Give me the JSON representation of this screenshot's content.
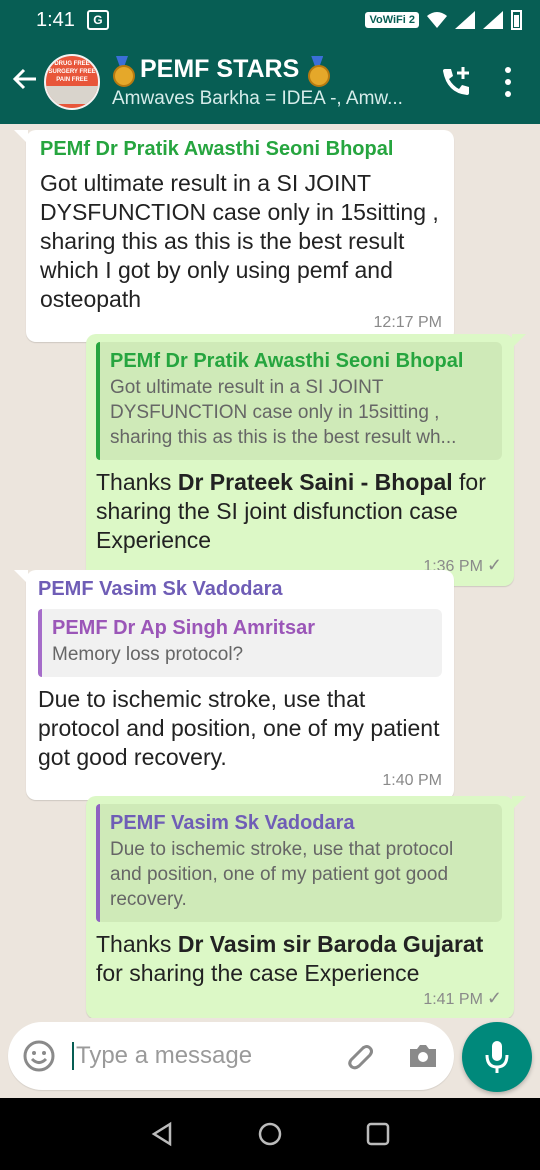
{
  "status_bar": {
    "time": "1:41",
    "network_label": "VoWiFi 2",
    "icons": [
      "translate-icon",
      "wifi-icon",
      "signal-icon",
      "battery-icon"
    ]
  },
  "header": {
    "title": "PEMF STARS",
    "subtitle": "Amwaves Barkha = IDEA -, Amw...",
    "avatar_text_1": "DRUG FREE",
    "avatar_text_2": "SURGERY FREE",
    "avatar_text_3": "PAIN FREE",
    "colors": {
      "bar": "#075e54"
    }
  },
  "messages": [
    {
      "direction": "in",
      "sender": "PEMf Dr Pratik Awasthi Seoni Bhopal",
      "text": "Got ultimate result in a SI JOINT DYSFUNCTION case only in 15sitting , sharing this as this is the best result which I got by only using pemf and osteopath",
      "time": "12:17 PM"
    },
    {
      "direction": "out",
      "quote": {
        "name": "PEMf Dr Pratik Awasthi Seoni Bhopal",
        "text": "Got ultimate result in a SI JOINT DYSFUNCTION case only in 15sitting , sharing this as this is the best result wh..."
      },
      "text_pre": "Thanks ",
      "text_bold": "Dr Prateek Saini - Bhopal",
      "text_post": " for sharing the SI joint disfunction case Experience",
      "time": "1:36 PM"
    },
    {
      "direction": "in",
      "sender": "PEMF Vasim Sk Vadodara",
      "quote": {
        "name": "PEMF Dr Ap Singh Amritsar",
        "text": "Memory loss protocol?"
      },
      "text": "Due to ischemic stroke, use that protocol and position, one of my patient got good recovery.",
      "time": "1:40 PM"
    },
    {
      "direction": "out",
      "quote": {
        "name": "PEMF Vasim Sk Vadodara",
        "text": "Due to ischemic stroke, use that protocol and position, one of my patient got good recovery."
      },
      "text_pre": "Thanks ",
      "text_bold": "Dr Vasim sir Baroda Gujarat",
      "text_post": " for sharing the case Experience",
      "time": "1:41 PM"
    }
  ],
  "composer": {
    "placeholder": "Type a message"
  },
  "colors": {
    "chat_bg": "#ece5dd",
    "outgoing_bubble": "#dcf8c6",
    "incoming_bubble": "#ffffff",
    "mic_button": "#00897b"
  }
}
